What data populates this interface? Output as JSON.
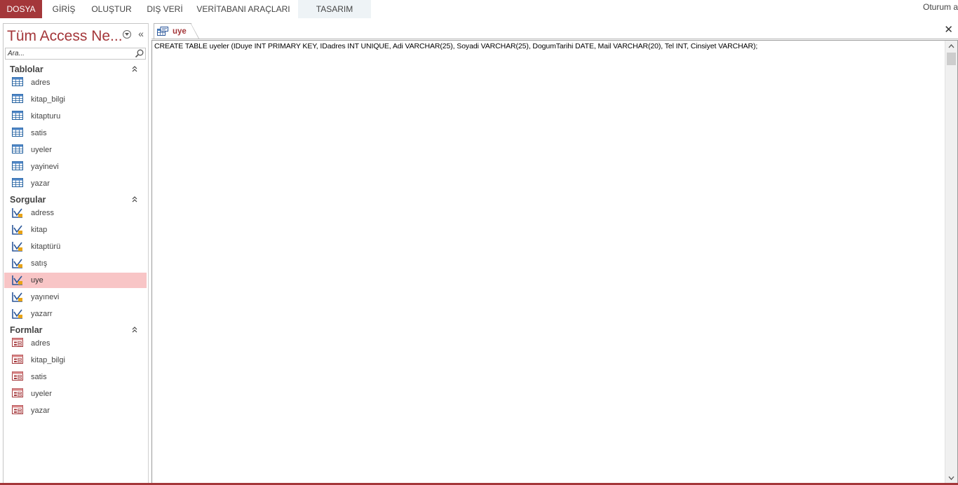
{
  "ribbon": {
    "tabs": [
      "DOSYA",
      "GİRİŞ",
      "OLUŞTUR",
      "DIŞ VERİ",
      "VERİTABANI ARAÇLARI",
      "TASARIM"
    ],
    "signin": "Oturum aç"
  },
  "nav": {
    "title": "Tüm Access Ne...",
    "search_placeholder": "Ara...",
    "groups": [
      {
        "label": "Tablolar",
        "items": [
          "adres",
          "kitap_bilgi",
          "kitapturu",
          "satis",
          "uyeler",
          "yayinevi",
          "yazar"
        ]
      },
      {
        "label": "Sorgular",
        "items": [
          "adress",
          "kitap",
          "kitaptürü",
          "satış",
          "uye",
          "yayınevi",
          "yazarr"
        ]
      },
      {
        "label": "Formlar",
        "items": [
          "adres",
          "kitap_bilgi",
          "satis",
          "uyeler",
          "yazar"
        ]
      }
    ],
    "selected": "uye"
  },
  "document": {
    "tab_label": "uye",
    "sql": "CREATE TABLE uyeler (IDuye INT PRIMARY KEY, IDadres INT UNIQUE, Adi VARCHAR(25), Soyadi VARCHAR(25), DogumTarihi DATE, Mail VARCHAR(20), Tel INT, Cinsiyet VARCHAR);"
  },
  "colors": {
    "accent": "#a4373a",
    "selected_row": "#f8c5c6",
    "tasarim_tab": "#eef3f6"
  },
  "icons": {
    "table": "table-icon",
    "query": "query-icon",
    "form": "form-icon"
  }
}
